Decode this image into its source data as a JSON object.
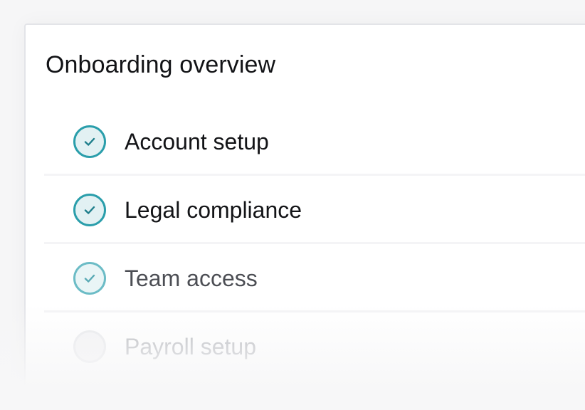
{
  "card": {
    "title": "Onboarding overview"
  },
  "steps": [
    {
      "label": "Account setup",
      "status": "complete",
      "icon": "check-circle-icon"
    },
    {
      "label": "Legal compliance",
      "status": "complete",
      "icon": "check-circle-icon"
    },
    {
      "label": "Team access",
      "status": "complete",
      "icon": "check-circle-icon"
    },
    {
      "label": "Payroll setup",
      "status": "pending",
      "icon": "empty-circle-icon"
    }
  ],
  "colors": {
    "accent": "#2a9eab",
    "accent_fill": "#e2f1f3",
    "text": "#131417",
    "muted_text": "#b2b4b9"
  }
}
